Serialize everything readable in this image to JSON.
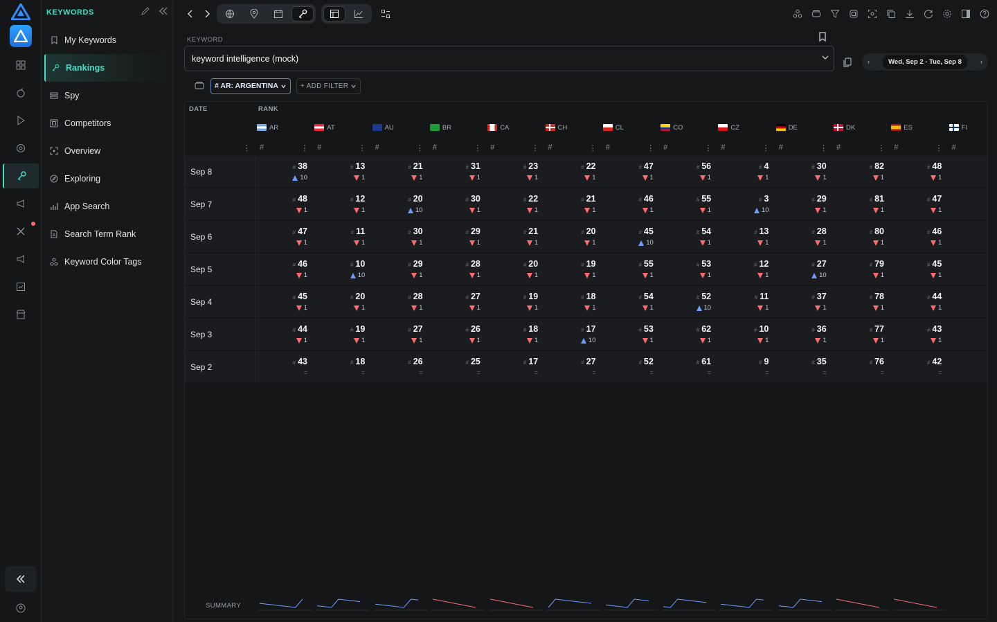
{
  "sidebar": {
    "title": "KEYWORDS",
    "items": [
      {
        "label": "My Keywords",
        "icon": "bookmarks-icon"
      },
      {
        "label": "Rankings",
        "icon": "key-icon",
        "active": true
      },
      {
        "label": "Spy",
        "icon": "layers-icon"
      },
      {
        "label": "Competitors",
        "icon": "copy-icon"
      },
      {
        "label": "Overview",
        "icon": "focus-icon"
      },
      {
        "label": "Exploring",
        "icon": "compass-icon"
      },
      {
        "label": "App Search",
        "icon": "bar-chart-icon"
      },
      {
        "label": "Search Term Rank",
        "icon": "document-icon"
      },
      {
        "label": "Keyword Color Tags",
        "icon": "tags-icon"
      }
    ]
  },
  "keyword": {
    "label": "KEYWORD",
    "value": "keyword intelligence (mock)"
  },
  "date_range": "Wed, Sep 2 - Tue, Sep 8",
  "filters": {
    "active_chip": "# AR: ARGENTINA",
    "add_filter": "+ ADD FILTER"
  },
  "table": {
    "date_header": "DATE",
    "rank_header": "RANK",
    "summary_label": "SUMMARY",
    "countries": [
      "AR",
      "AT",
      "AU",
      "BR",
      "CA",
      "CH",
      "CL",
      "CO",
      "CZ",
      "DE",
      "DK",
      "ES",
      "FI"
    ],
    "rows": [
      {
        "date": "Sep 8",
        "ranks": [
          38,
          13,
          21,
          31,
          23,
          22,
          47,
          56,
          4,
          30,
          82,
          48
        ],
        "changes": [
          "up10",
          "dn1",
          "dn1",
          "dn1",
          "dn1",
          "dn1",
          "dn1",
          "dn1",
          "dn1",
          "dn1",
          "dn1",
          "dn1"
        ]
      },
      {
        "date": "Sep 7",
        "ranks": [
          48,
          12,
          20,
          30,
          22,
          21,
          46,
          55,
          3,
          29,
          81,
          47
        ],
        "changes": [
          "dn1",
          "dn1",
          "up10",
          "dn1",
          "dn1",
          "dn1",
          "dn1",
          "dn1",
          "up10",
          "dn1",
          "dn1",
          "dn1"
        ]
      },
      {
        "date": "Sep 6",
        "ranks": [
          47,
          11,
          30,
          29,
          21,
          20,
          45,
          54,
          13,
          28,
          80,
          46
        ],
        "changes": [
          "dn1",
          "dn1",
          "dn1",
          "dn1",
          "dn1",
          "dn1",
          "up10",
          "dn1",
          "dn1",
          "dn1",
          "dn1",
          "dn1"
        ]
      },
      {
        "date": "Sep 5",
        "ranks": [
          46,
          10,
          29,
          28,
          20,
          19,
          55,
          53,
          12,
          27,
          79,
          45
        ],
        "changes": [
          "dn1",
          "up10",
          "dn1",
          "dn1",
          "dn1",
          "dn1",
          "dn1",
          "dn1",
          "dn1",
          "up10",
          "dn1",
          "dn1"
        ]
      },
      {
        "date": "Sep 4",
        "ranks": [
          45,
          20,
          28,
          27,
          19,
          18,
          54,
          52,
          11,
          37,
          78,
          44
        ],
        "changes": [
          "dn1",
          "dn1",
          "dn1",
          "dn1",
          "dn1",
          "dn1",
          "dn1",
          "up10",
          "dn1",
          "dn1",
          "dn1",
          "dn1"
        ]
      },
      {
        "date": "Sep 3",
        "ranks": [
          44,
          19,
          27,
          26,
          18,
          17,
          53,
          62,
          10,
          36,
          77,
          43
        ],
        "changes": [
          "dn1",
          "dn1",
          "dn1",
          "dn1",
          "dn1",
          "up10",
          "dn1",
          "dn1",
          "dn1",
          "dn1",
          "dn1",
          "dn1"
        ]
      },
      {
        "date": "Sep 2",
        "ranks": [
          43,
          18,
          26,
          25,
          17,
          27,
          52,
          61,
          9,
          35,
          76,
          42
        ],
        "changes": [
          "eq",
          "eq",
          "eq",
          "eq",
          "eq",
          "eq",
          "eq",
          "eq",
          "eq",
          "eq",
          "eq",
          "eq"
        ]
      }
    ]
  },
  "colors": {
    "accent": "#3fe0c5",
    "down": "#ff6b6b",
    "up": "#6f9cff",
    "chip_border": "#5d7fd0"
  }
}
